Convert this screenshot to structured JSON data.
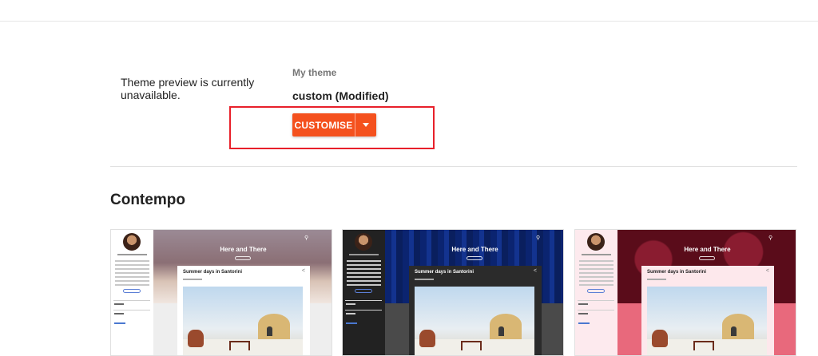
{
  "preview": {
    "message": "Theme preview is currently unavailable."
  },
  "current_theme": {
    "label": "My theme",
    "name": "custom (Modified)",
    "customise_label": "CUSTOMISE",
    "dropdown_icon": "caret-down-icon"
  },
  "colors": {
    "accent": "#f4511e",
    "highlight": "#e8202a"
  },
  "section": {
    "title": "Contempo"
  },
  "thumbnails": [
    {
      "blog_title": "Here and There",
      "post_title": "Summer days in Santorini",
      "variant": "light",
      "hero_color": "#8a7a86",
      "card_bg": "#ffffff",
      "lower_bg": "#eeeeee",
      "sidebar_bg": "#ffffff"
    },
    {
      "blog_title": "Here and There",
      "post_title": "Summer days in Santorini",
      "variant": "dark",
      "hero_color": "#0d2a78",
      "card_bg": "#2b2b2b",
      "lower_bg": "#4a4a4a",
      "sidebar_bg": "#222222"
    },
    {
      "blog_title": "Here and There",
      "post_title": "Summer days in Santorini",
      "variant": "pink",
      "hero_color": "#6a1020",
      "card_bg": "#fde8ec",
      "lower_bg": "#e8697c",
      "sidebar_bg": "#fdeaee"
    }
  ]
}
